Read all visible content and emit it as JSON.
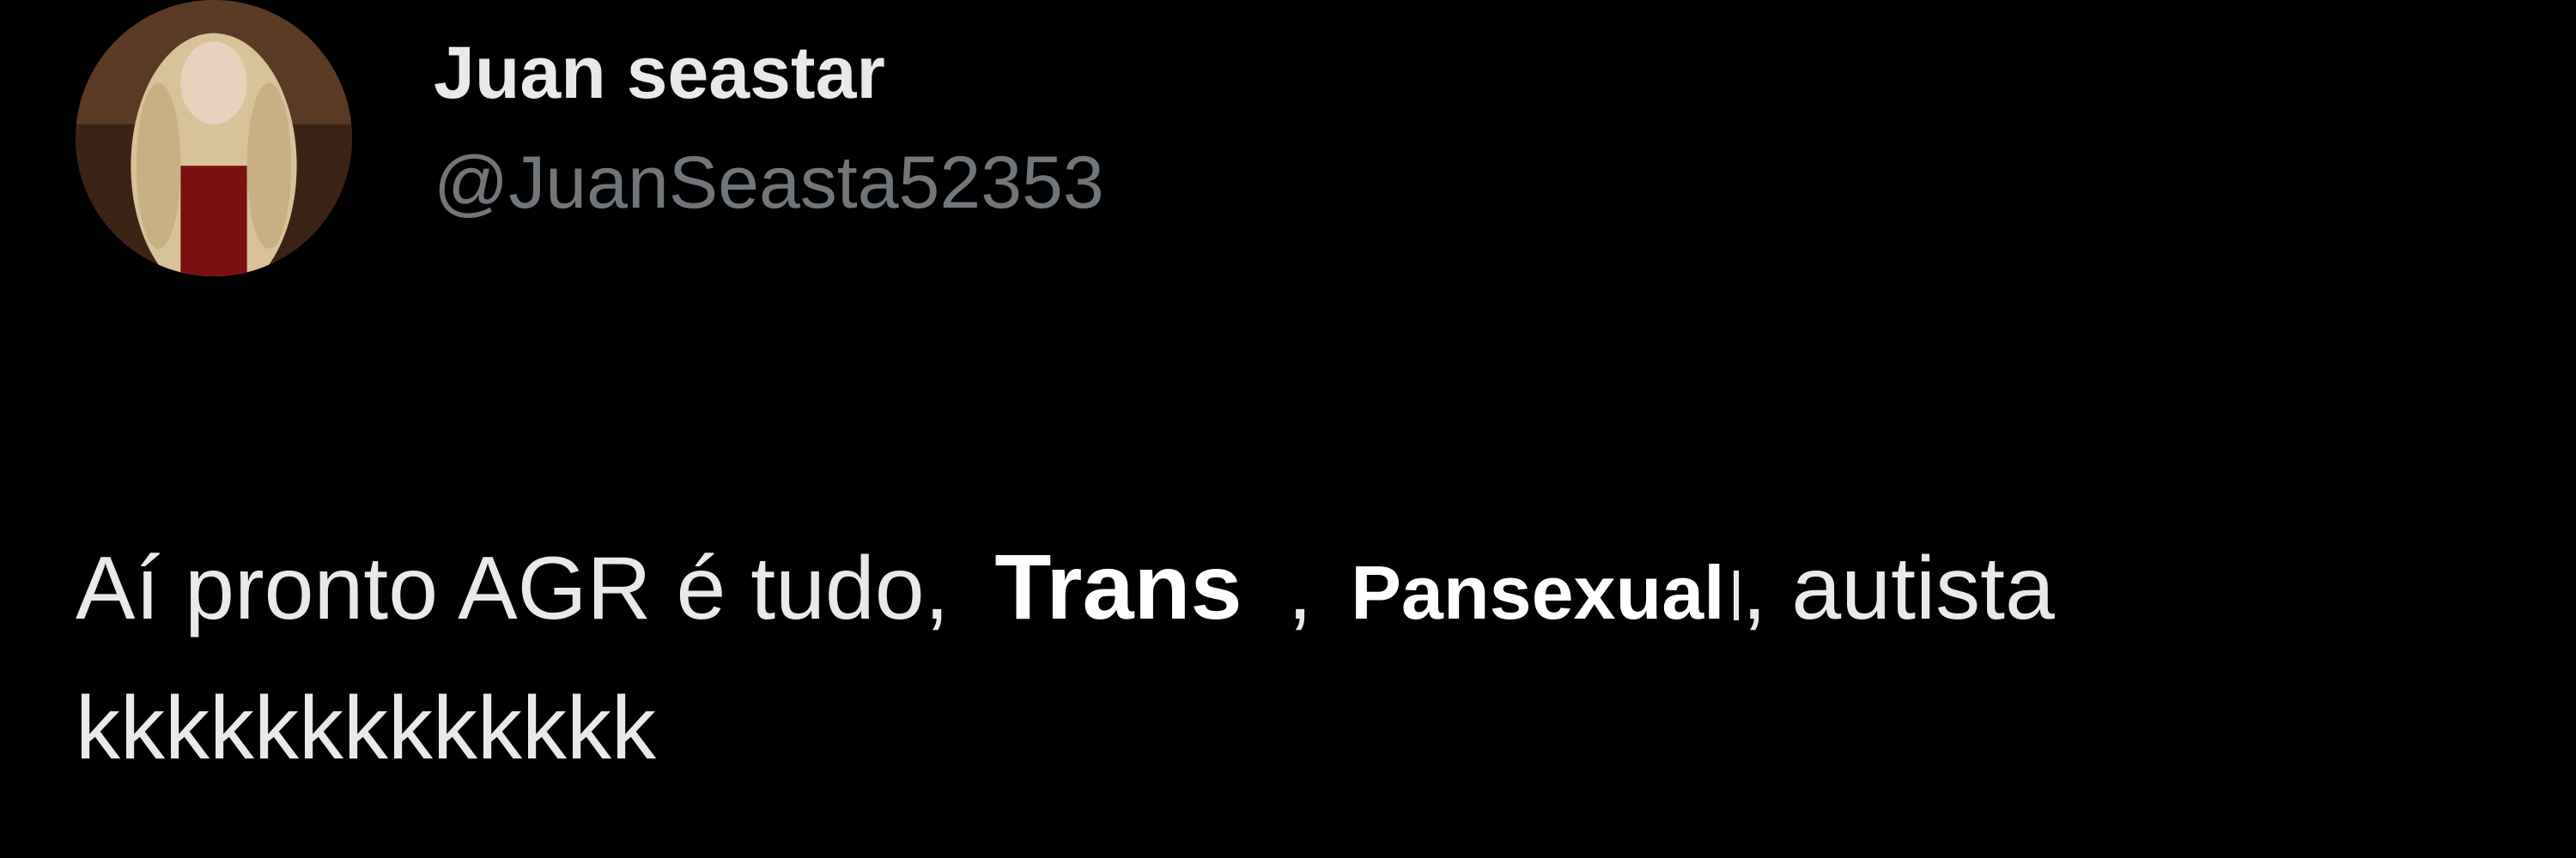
{
  "author": {
    "display_name": "Juan seastar",
    "handle": "@JuanSeasta52353",
    "avatar_icon": "profile-photo-icon"
  },
  "tweet": {
    "text_part1": "Aí pronto AGR é tudo, ",
    "overlay_word1": "Trans",
    "text_comma": " , ",
    "overlay_word2": "Pansexual",
    "text_part2": ", autista",
    "text_line2": "kkkkkkkkkkkkk"
  },
  "colors": {
    "background": "#000000",
    "primary_text": "#e7e9ea",
    "secondary_text": "#71767b",
    "overlay_text": "#ffffff"
  }
}
